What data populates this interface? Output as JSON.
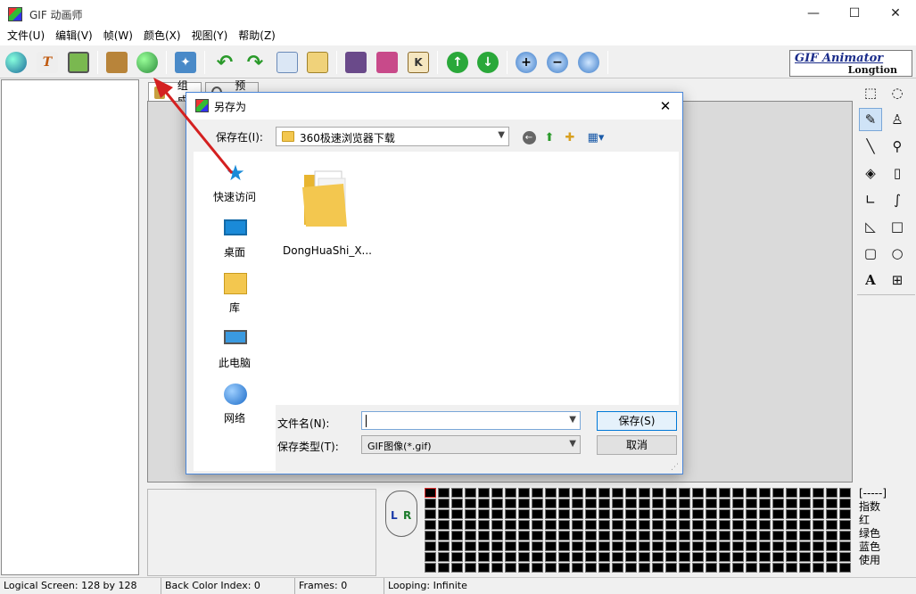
{
  "window": {
    "title": "GIF 动画师",
    "controls": [
      "—",
      "☐",
      "✕"
    ]
  },
  "menu": [
    "文件(U)",
    "编辑(V)",
    "帧(W)",
    "颜色(X)",
    "视图(Y)",
    "帮助(Z)"
  ],
  "brand": {
    "line1": "GIF Animator",
    "line2": "Longtion"
  },
  "tabs": {
    "compose": "组成",
    "preview": "预览"
  },
  "dialog": {
    "title": "另存为",
    "save_in_label": "保存在(I):",
    "save_in_value": "360极速浏览器下载",
    "places": [
      "快速访问",
      "桌面",
      "库",
      "此电脑",
      "网络"
    ],
    "file": {
      "name": "DongHuaShi_X..."
    },
    "filename_label": "文件名(N):",
    "filename_value": "",
    "filetype_label": "保存类型(T):",
    "filetype_value": "GIF图像(*.gif)",
    "save_button": "保存(S)",
    "cancel_button": "取消"
  },
  "mouse": {
    "left": "L",
    "right": "R"
  },
  "color_info": [
    "[-----]",
    "指数",
    "红",
    "绿色",
    "蓝色",
    "使用"
  ],
  "status": {
    "logical_screen": "Logical Screen: 128 by 128",
    "back_color": "Back Color Index: 0",
    "frames": "Frames: 0",
    "looping": "Looping: Infinite"
  },
  "colors": {
    "accent": "#0078d7",
    "arrow": "#d42020",
    "brand_blue": "#1a2c8a"
  }
}
